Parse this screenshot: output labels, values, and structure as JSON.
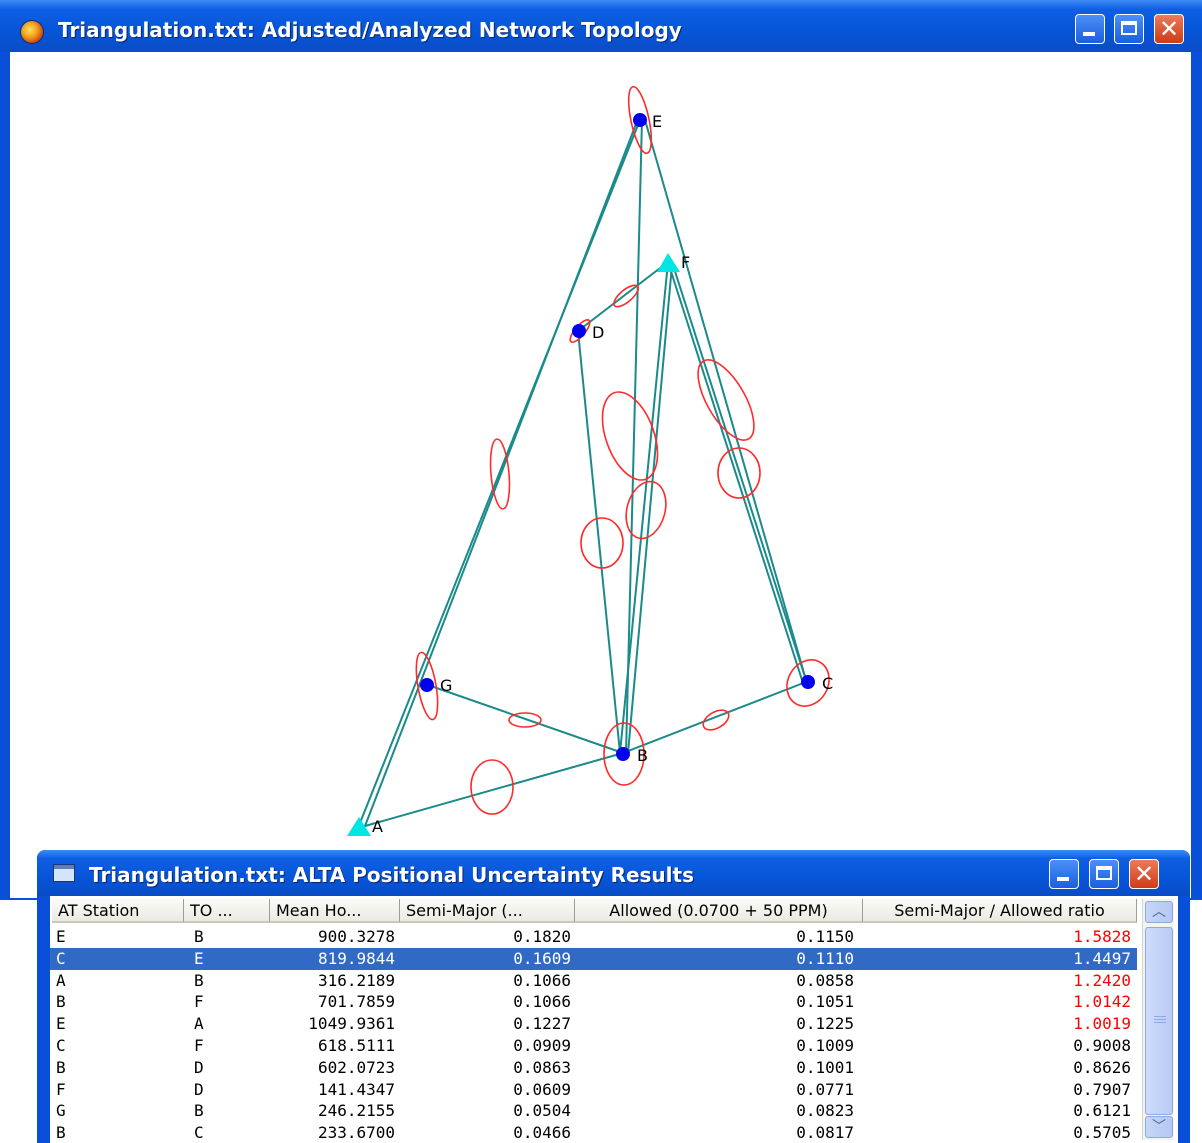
{
  "topology_window": {
    "title": "Triangulation.txt: Adjusted/Analyzed Network Topology",
    "stations": {
      "E": {
        "label": "E"
      },
      "F": {
        "label": "F"
      },
      "D": {
        "label": "D"
      },
      "G": {
        "label": "G"
      },
      "C": {
        "label": "C"
      },
      "B": {
        "label": "B"
      },
      "A": {
        "label": "A"
      }
    },
    "colors": {
      "line": "#1a8a8a",
      "ellipse": "#ff2a2a",
      "station": "#0000ee",
      "control": "#00e5e5"
    }
  },
  "results_window": {
    "title": "Triangulation.txt: ALTA Positional Uncertainty Results",
    "columns": [
      "AT Station",
      "TO ...",
      "Mean Ho...",
      "Semi-Major (...",
      "Allowed (0.0700 + 50 PPM)",
      "Semi-Major / Allowed ratio"
    ],
    "rows": [
      {
        "at": "E",
        "to": "B",
        "mean": "900.3278",
        "semi": "0.1820",
        "allowed": "0.1150",
        "ratio": "1.5828",
        "exceeds": true
      },
      {
        "at": "C",
        "to": "E",
        "mean": "819.9844",
        "semi": "0.1609",
        "allowed": "0.1110",
        "ratio": "1.4497",
        "exceeds": true,
        "selected": true
      },
      {
        "at": "A",
        "to": "B",
        "mean": "316.2189",
        "semi": "0.1066",
        "allowed": "0.0858",
        "ratio": "1.2420",
        "exceeds": true
      },
      {
        "at": "B",
        "to": "F",
        "mean": "701.7859",
        "semi": "0.1066",
        "allowed": "0.1051",
        "ratio": "1.0142",
        "exceeds": true
      },
      {
        "at": "E",
        "to": "A",
        "mean": "1049.9361",
        "semi": "0.1227",
        "allowed": "0.1225",
        "ratio": "1.0019",
        "exceeds": true
      },
      {
        "at": "C",
        "to": "F",
        "mean": "618.5111",
        "semi": "0.0909",
        "allowed": "0.1009",
        "ratio": "0.9008",
        "exceeds": false
      },
      {
        "at": "B",
        "to": "D",
        "mean": "602.0723",
        "semi": "0.0863",
        "allowed": "0.1001",
        "ratio": "0.8626",
        "exceeds": false
      },
      {
        "at": "F",
        "to": "D",
        "mean": "141.4347",
        "semi": "0.0609",
        "allowed": "0.0771",
        "ratio": "0.7907",
        "exceeds": false
      },
      {
        "at": "G",
        "to": "B",
        "mean": "246.2155",
        "semi": "0.0504",
        "allowed": "0.0823",
        "ratio": "0.6121",
        "exceeds": false
      },
      {
        "at": "B",
        "to": "C",
        "mean": "233.6700",
        "semi": "0.0466",
        "allowed": "0.0817",
        "ratio": "0.5705",
        "exceeds": false
      }
    ]
  }
}
